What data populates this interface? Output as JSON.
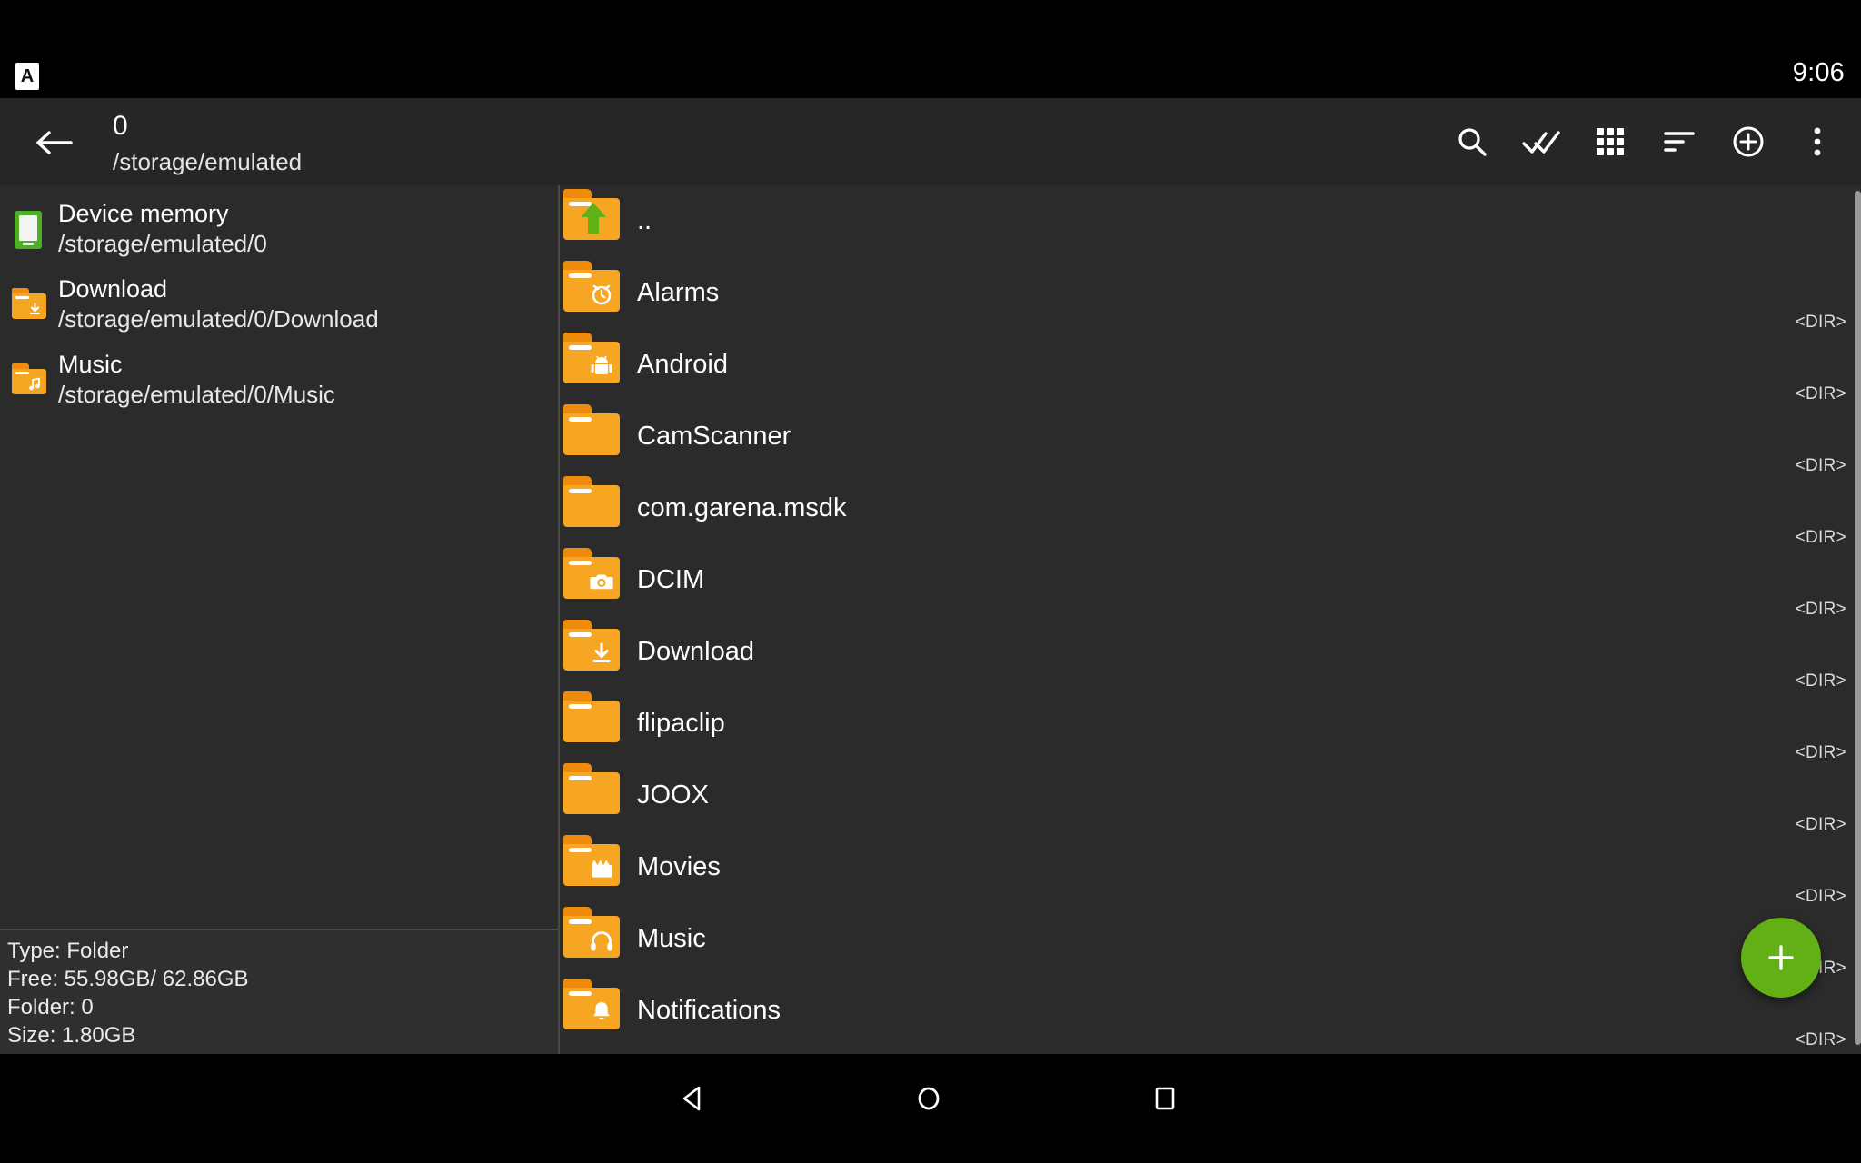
{
  "statusbar": {
    "notification_icon": "app-badge-icon",
    "notification_letter": "A",
    "clock": "9:06"
  },
  "appbar": {
    "back_icon": "arrow-left-icon",
    "title": "0",
    "subtitle": "/storage/emulated",
    "actions": [
      {
        "name": "search-icon",
        "label": "Search"
      },
      {
        "name": "select-all-icon",
        "label": "Select all"
      },
      {
        "name": "grid-view-icon",
        "label": "Grid view"
      },
      {
        "name": "sort-icon",
        "label": "Sort"
      },
      {
        "name": "add-circle-icon",
        "label": "Add"
      },
      {
        "name": "overflow-menu-icon",
        "label": "More options"
      }
    ],
    "resize_handle": "resize-handle-icon"
  },
  "sidebar": {
    "bookmarks": [
      {
        "name": "Device memory",
        "path": "/storage/emulated/0",
        "icon": "device-memory-icon",
        "icon_type": "device"
      },
      {
        "name": "Download",
        "path": "/storage/emulated/0/Download",
        "icon": "folder-download-icon",
        "icon_type": "folder",
        "badge": "↓"
      },
      {
        "name": "Music",
        "path": "/storage/emulated/0/Music",
        "icon": "folder-music-icon",
        "icon_type": "folder",
        "badge": "♫"
      }
    ],
    "info": {
      "type": "Type: Folder",
      "free": "Free: 55.98GB/ 62.86GB",
      "folder": "Folder: 0",
      "size": "Size: 1.80GB"
    }
  },
  "filelist": {
    "dir_tag": "<DIR>",
    "items": [
      {
        "name": "..",
        "icon": "folder-up-icon",
        "badge": "up",
        "dir": false
      },
      {
        "name": "Alarms",
        "icon": "folder-alarm-icon",
        "badge": "alarm",
        "dir": true
      },
      {
        "name": "Android",
        "icon": "folder-android-icon",
        "badge": "android",
        "dir": true
      },
      {
        "name": "CamScanner",
        "icon": "folder-icon",
        "badge": "",
        "dir": true
      },
      {
        "name": "com.garena.msdk",
        "icon": "folder-icon",
        "badge": "",
        "dir": true
      },
      {
        "name": "DCIM",
        "icon": "folder-camera-icon",
        "badge": "camera",
        "dir": true
      },
      {
        "name": "Download",
        "icon": "folder-download-icon",
        "badge": "down",
        "dir": true
      },
      {
        "name": "flipaclip",
        "icon": "folder-icon",
        "badge": "",
        "dir": true
      },
      {
        "name": "JOOX",
        "icon": "folder-icon",
        "badge": "",
        "dir": true
      },
      {
        "name": "Movies",
        "icon": "folder-movies-icon",
        "badge": "movie",
        "dir": true
      },
      {
        "name": "Music",
        "icon": "folder-music-icon",
        "badge": "head",
        "dir": true
      },
      {
        "name": "Notifications",
        "icon": "folder-notifications-icon",
        "badge": "bell",
        "dir": true
      }
    ]
  },
  "fab": {
    "name": "add-fab",
    "label": "+",
    "color": "#62b016"
  },
  "navbar": {
    "back": "nav-back-icon",
    "home": "nav-home-icon",
    "recents": "nav-recents-icon"
  },
  "colors": {
    "background": "#2b2b2b",
    "appbar": "#262626",
    "folder": "#f6a623",
    "folder_tab": "#ef8b0c",
    "accent_green": "#62b016",
    "device_green": "#4caf26"
  }
}
